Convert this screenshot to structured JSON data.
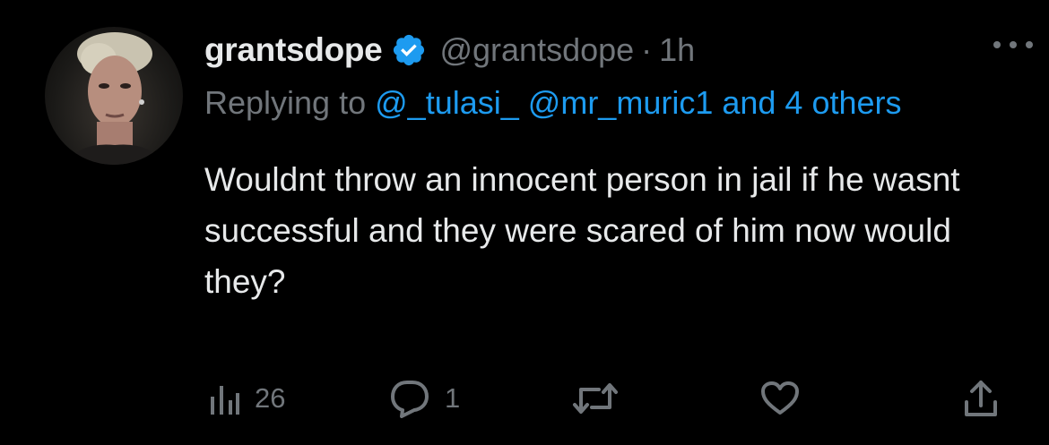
{
  "tweet": {
    "display_name": "grantsdope",
    "handle": "@grantsdope",
    "separator": "·",
    "time": "1h",
    "replying_to_prefix": "Replying to",
    "mentions": [
      "@_tulasi_",
      "@mr_muric1",
      "and 4 others"
    ],
    "body": "Wouldnt throw an innocent person in jail if he wasnt successful and they were scared of him now would they?"
  },
  "actions": {
    "views_count": "26",
    "reply_count": "1"
  },
  "icons": {
    "verified": "verified-badge-icon",
    "more": "more-dots-icon",
    "views": "views-chart-icon",
    "reply": "reply-bubble-icon",
    "retweet": "retweet-icon",
    "like": "heart-icon",
    "share": "share-icon"
  },
  "colors": {
    "background": "#000000",
    "text_primary": "#e7e9ea",
    "text_secondary": "#71767b",
    "accent": "#1d9bf0"
  }
}
